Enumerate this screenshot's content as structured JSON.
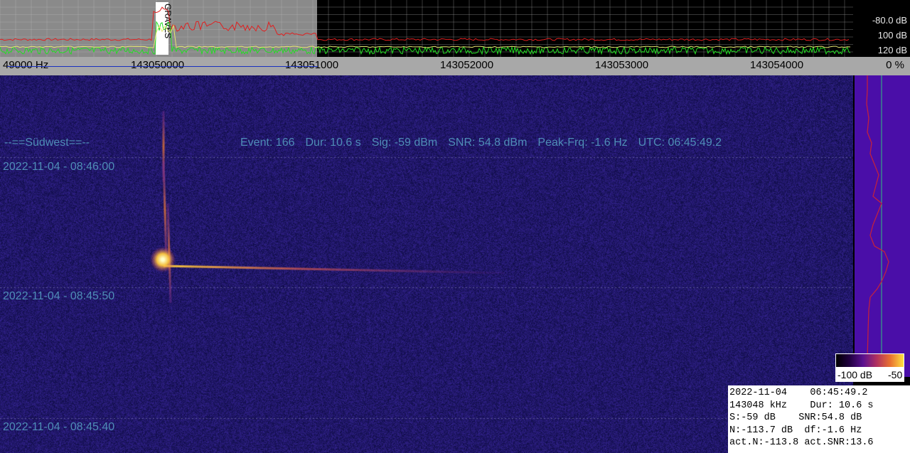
{
  "spectrum": {
    "db_labels": [
      "-80.0 dB",
      "100 dB",
      "120 dB"
    ],
    "marker_text": "GRAVES"
  },
  "frequency_axis": {
    "labels": [
      "49000 Hz",
      "143050000",
      "143051000",
      "143052000",
      "143053000",
      "143054000"
    ]
  },
  "percent_display": "0 %",
  "waterfall": {
    "station_label": "--==Südwest==--",
    "event": {
      "event": "Event: 166",
      "dur": "Dur: 10.6 s",
      "sig": "Sig: -59 dBm",
      "snr": "SNR: 54.8 dBm",
      "peak": "Peak-Frq: -1.6 Hz",
      "utc": "UTC: 06:45:49.2"
    },
    "timestamps": [
      "2022-11-04 - 08:46:00",
      "2022-11-04 - 08:45:50",
      "2022-11-04 - 08:45:40"
    ]
  },
  "colorbar": {
    "min_label": "-100 dB",
    "max_label": "-50"
  },
  "info_box": {
    "line1": "2022-11-04    06:45:49.2",
    "line2": "143048 kHz    Dur: 10.6 s",
    "line3": "S:-59 dB    SNR:54.8 dB",
    "line4": "N:-113.7 dB  df:-1.6 Hz",
    "line5": "act.N:-113.8 act.SNR:13.6"
  },
  "colors": {
    "spectrum_grey": "#8a8a8a",
    "noise_trace": "#22dd22",
    "peak_trace": "#e02020",
    "avg_trace": "#e8e870",
    "waterfall_bg": "#14125a",
    "label_text": "#4f8db7"
  }
}
